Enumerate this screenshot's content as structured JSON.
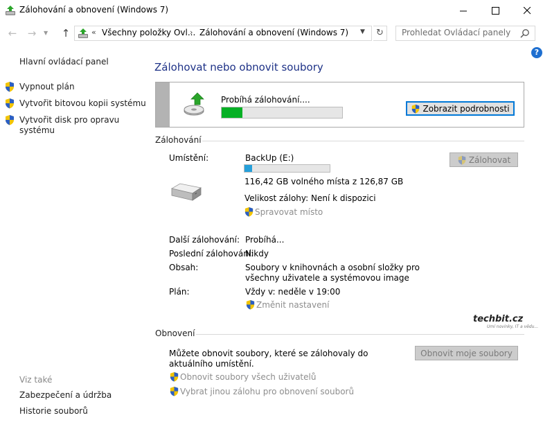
{
  "window": {
    "title": "Zálohování a obnovení (Windows 7)"
  },
  "address_bar": {
    "overflow": "«",
    "crumbs": [
      "Všechny položky Ovl...",
      "Zálohování a obnovení (Windows 7)"
    ],
    "separator": "›"
  },
  "search": {
    "placeholder": "Prohledat Ovládací panely"
  },
  "help": {
    "label": "?"
  },
  "sidebar": {
    "home": "Hlavní ovládací panel",
    "tasks": [
      "Vypnout plán",
      "Vytvořit bitovou kopii systému",
      "Vytvořit disk pro opravu systému"
    ],
    "see_also_title": "Viz také",
    "see_also": [
      "Zabezpečení a údržba",
      "Historie souborů"
    ]
  },
  "main": {
    "title": "Zálohovat nebo obnovit soubory",
    "status": {
      "text": "Probíhá zálohování....",
      "progress_fraction": 0.17,
      "details_button": "Zobrazit podrobnosti"
    },
    "backup": {
      "section_title": "Zálohování",
      "location_label": "Umístění:",
      "location_value": "BackUp (E:)",
      "drive_used_fraction": 0.09,
      "free_space": "116,42 GB volného místa z 126,87 GB",
      "backup_size": "Velikost zálohy: Není k dispozici",
      "manage_space": "Spravovat místo",
      "backup_button": "Zálohovat",
      "next_label": "Další zálohování:",
      "next_value": "Probíhá...",
      "last_label": "Poslední zálohování:",
      "last_value": "Nikdy",
      "contents_label": "Obsah:",
      "contents_value": "Soubory v knihovnách a osobní složky pro všechny uživatele a systémovou image",
      "schedule_label": "Plán:",
      "schedule_value": "Vždy v: neděle v 19:00",
      "change_settings": "Změnit nastavení"
    },
    "restore": {
      "section_title": "Obnovení",
      "description": "Můžete obnovit soubory, které se zálohovaly do aktuálního umístění.",
      "restore_button": "Obnovit moje soubory",
      "links": [
        "Obnovit soubory všech uživatelů",
        "Vybrat jinou zálohu pro obnovení souborů"
      ]
    }
  },
  "watermark": {
    "brand": "techbit.cz",
    "tagline": "Umí novinky, IT a vědu..."
  },
  "colors": {
    "title_blue": "#1e3287",
    "progress_green": "#06b025",
    "drive_blue": "#26a0da",
    "focus_blue": "#0078d7"
  }
}
